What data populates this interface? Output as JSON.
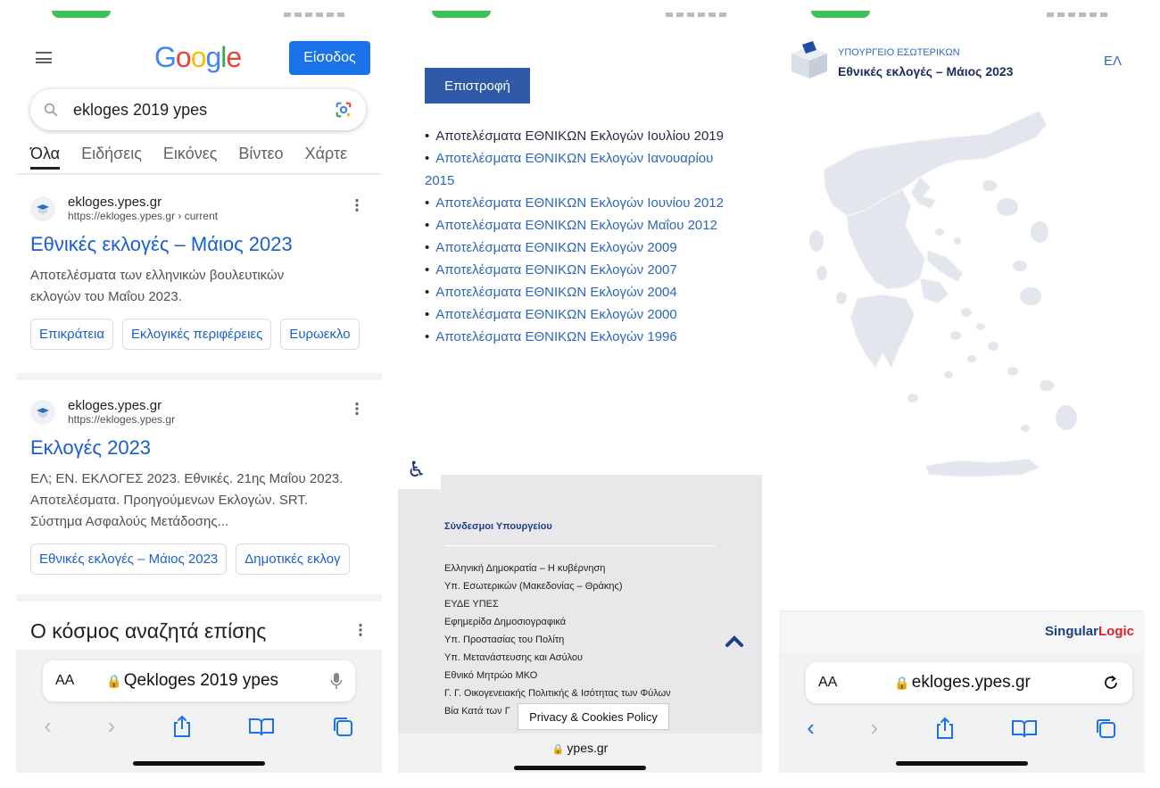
{
  "panel1": {
    "signin_label": "Είσοδος",
    "search_query": "ekloges 2019 ypes",
    "tabs": [
      "Όλα",
      "Ειδήσεις",
      "Εικόνες",
      "Βίντεο",
      "Χάρτε"
    ],
    "results": [
      {
        "site_name": "ekloges.ypes.gr",
        "site_url": "https://ekloges.ypes.gr › current",
        "title": "Εθνικές εκλογές – Μάιος 2023",
        "snippet": "Αποτελέσματα των ελληνικών βουλευτικών εκλογών του Μαΐου 2023.",
        "chips": [
          "Επικράτεια",
          "Εκλογικές περιφέρειες",
          "Ευρωεκλο"
        ]
      },
      {
        "site_name": "ekloges.ypes.gr",
        "site_url": "https://ekloges.ypes.gr",
        "title": "Εκλογές 2023",
        "snippet": "ΕΛ; ΕΝ. ΕΚΛΟΓΕΣ 2023. Εθνικές. 21ης Μαΐου 2023. Αποτελέσματα. Προηγούμενων Εκλογών. SRT. Σύστημα Ασφαλούς Μετάδοσης...",
        "chips": [
          "Εθνικές εκλογές – Μάιος 2023",
          "Δημοτικές εκλογ"
        ]
      }
    ],
    "people_also_search": "Ο κόσμος αναζητά επίσης",
    "address_bar": {
      "aa": "AA",
      "text": "Qekloges 2019 ypes"
    }
  },
  "panel2": {
    "back_label": "Επιστροφή",
    "elections": [
      "Αποτελέσματα ΕΘΝΙΚΩΝ Εκλογών Ιουλίου 2019",
      "Αποτελέσματα ΕΘΝΙΚΩΝ Εκλογών Ιανουαρίου 2015",
      "Αποτελέσματα ΕΘΝΙΚΩΝ Εκλογών Ιουνίου 2012",
      "Αποτελέσματα ΕΘΝΙΚΩΝ Εκλογών Μαΐου 2012",
      "Αποτελέσματα ΕΘΝΙΚΩΝ Εκλογών 2009",
      "Αποτελέσματα ΕΘΝΙΚΩΝ Εκλογών 2007",
      "Αποτελέσματα ΕΘΝΙΚΩΝ Εκλογών 2004",
      "Αποτελέσματα ΕΘΝΙΚΩΝ Εκλογών 2000",
      "Αποτελέσματα ΕΘΝΙΚΩΝ Εκλογών 1996"
    ],
    "footer_title": "Σύνδεσμοι Υπουργείου",
    "footer_links": [
      "Ελληνική Δημοκρατία – Η κυβέρνηση",
      "Υπ. Εσωτερικών (Μακεδονίας – Θράκης)",
      "ΕΥΔΕ ΥΠΕΣ",
      "Εφημερίδα Δημοσιογραφικά",
      "Υπ. Προστασίας του Πολίτη",
      "Υπ. Μετανάστευσης και Ασύλου",
      "Εθνικό Μητρώο ΜΚΟ",
      "Γ. Γ. Οικογενειακής Πολιτικής & Ισότητας των Φύλων",
      "Βία Κατά των Γ"
    ],
    "privacy_label": "Privacy & Cookies Policy",
    "url": "ypes.gr"
  },
  "panel3": {
    "ministry": "ΥΠΟΥΡΓΕΙΟ ΕΣΩΤΕΡΙΚΩΝ",
    "title": "Εθνικές εκλογές – Μάιος 2023",
    "lang": "ΕΛ",
    "brand_singular": "Singular",
    "brand_logic": "Logic",
    "address_bar": {
      "aa": "AA",
      "text": "ekloges.ypes.gr"
    }
  },
  "colors": {
    "google_blue": "#1a73e8",
    "link_blue": "#1a5fd0",
    "ypes_button": "#2e5aa8",
    "map_fill": "#e3e6ec"
  }
}
